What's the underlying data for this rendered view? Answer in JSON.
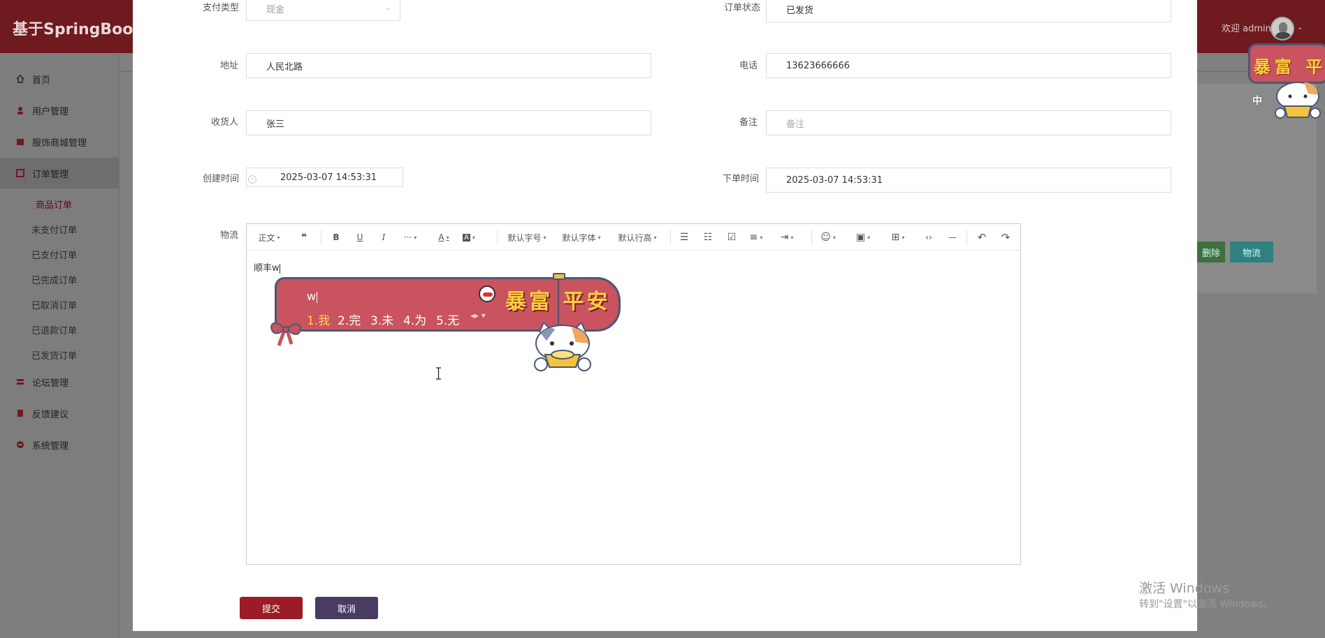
{
  "app": {
    "title": "基于SpringBoot小",
    "welcome": "欢迎 admin",
    "chevron": "⌄"
  },
  "sidebar": {
    "items": [
      {
        "label": "首页",
        "icon": "home-icon"
      },
      {
        "label": "用户管理",
        "icon": "user-icon"
      },
      {
        "label": "服饰商城管理",
        "icon": "shop-icon"
      },
      {
        "label": "订单管理",
        "icon": "order-icon"
      },
      {
        "label": "论坛管理",
        "icon": "forum-icon"
      },
      {
        "label": "反馈建议",
        "icon": "feedback-icon"
      },
      {
        "label": "系统管理",
        "icon": "system-icon"
      }
    ],
    "sub_items": [
      "商品订单",
      "未支付订单",
      "已支付订单",
      "已完成订单",
      "已取消订单",
      "已退款订单",
      "已发货订单"
    ]
  },
  "background": {
    "delete_button": "删除",
    "logistics_button": "物流"
  },
  "form": {
    "payment_type": {
      "label": "支付类型",
      "value": "现金"
    },
    "order_status": {
      "label": "订单状态",
      "value": "已发货"
    },
    "address": {
      "label": "地址",
      "value": "人民北路"
    },
    "phone": {
      "label": "电话",
      "value": "13623666666"
    },
    "receiver": {
      "label": "收货人",
      "value": "张三"
    },
    "remark": {
      "label": "备注",
      "placeholder": "备注"
    },
    "create_time": {
      "label": "创建时间",
      "value": "2025-03-07 14:53:31"
    },
    "order_time": {
      "label": "下单时间",
      "value": "2025-03-07 14:53:31"
    },
    "logistics": {
      "label": "物流",
      "content": "顺丰w"
    }
  },
  "editor_toolbar": {
    "paragraph": "正文",
    "quote": "❝",
    "bold": "B",
    "underline": "U",
    "italic": "I",
    "more": "···",
    "font_color": "A",
    "bg_color": "A",
    "font_size": "默认字号",
    "font_family": "默认字体",
    "line_height": "默认行高",
    "bullet_list": "☰",
    "numbered_list": "☷",
    "todo": "☑",
    "justify": "≡",
    "indent": "⇥",
    "emotion": "☺",
    "image": "▣",
    "table": "⊞",
    "code": "‹›",
    "divider": "—",
    "undo": "↶",
    "redo": "↷",
    "caret": "▾"
  },
  "ime": {
    "typed": "w",
    "candidates": [
      "1.我",
      "2.完",
      "3.未",
      "4.为",
      "5.无"
    ],
    "arrows": "◂▸ ▾",
    "banner": "暴富 平安"
  },
  "corner_sticker": {
    "banner": "暴富 平安",
    "mode": "中"
  },
  "actions": {
    "submit": "提交",
    "cancel": "取消"
  },
  "watermark": {
    "line1": "激活 Windows",
    "line2": "转到\"设置\"以激活 Windows。"
  },
  "colors": {
    "header": "#6e1a1e",
    "submit": "#9b1b26",
    "cancel": "#4a3b63",
    "ime": "#c9535e",
    "ime_border": "#4a5877"
  }
}
